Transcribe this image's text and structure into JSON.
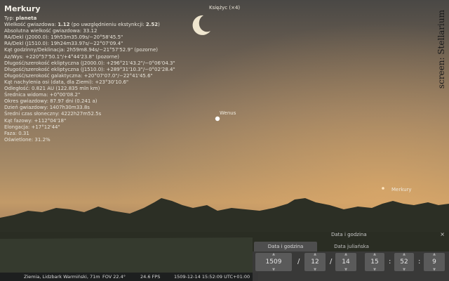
{
  "object": {
    "name": "Merkury",
    "type_label": "Typ:",
    "type_value": "planeta",
    "magnitude_label": "Wielkość gwiazdowa:",
    "magnitude_value": "1.12",
    "magnitude_ext_label": "(po uwzględnieniu ekstynkcji:",
    "magnitude_ext_value": "2.52",
    "magnitude_ext_close": ")",
    "lines": [
      "Absolutna wielkość gwiazdowa: 33.12",
      "RA/Dekl (J2000.0): 19h53m35.09s/−20°58'45.5\"",
      "RA/Dekl (J1510.0): 19h24m33.97s/−22°07'09.4\"",
      "Kąt godzinny/Deklinacja: 2h59m8.94s/−21°57'52.9\" (pozorne)",
      "Az/Wys: +220°57'50.1\"/+4°44'23.8\" (pozorne)",
      "Długość/szerokość ekliptyczna (J2000.0): +296°21'43.2\"/−0°06'04.3\"",
      "Długość/szerokość ekliptyczna (J1510.0): +289°31'10.3\"/−0°02'28.4\"",
      "Długość/szerokość galaktyczna: +20°07'07.0\"/−22°41'45.6\"",
      "Kąt nachylenia osi (data, dla Ziemi): +23°30'10.6\"",
      "Odległość: 0.821 AU (122.835 mln km)",
      "Średnica widoma: +0°00'08.2\"",
      "Okres gwiazdowy: 87.97 dni (0.241 a)",
      "Dzień gwiazdowy: 1407h30m33.8s",
      "Średni czas słoneczny: 4222h27m52.5s",
      "Kąt fazowy: +112°04'18\"",
      "Elongacja: +17°12'44\"",
      "Faza: 0.31",
      "Oświetlone: 31.2%"
    ]
  },
  "sky_labels": {
    "moon": "Księżyc (×4)",
    "venus": "Wenus",
    "mercury": "Merkury"
  },
  "watermark": "screen: Stellarium",
  "status_bar": {
    "location": "Ziemia, Lidzbark Warmiński, 71m",
    "fov": "FOV 22.4°",
    "fps": "24.6 FPS",
    "datetime": "1509-12-14   15:52:09 UTC+01:00"
  },
  "datetime_panel": {
    "title": "Data i godzina",
    "close_icon": "×",
    "tab_datetime": "Data i godzina",
    "tab_julian": "Data juliańska",
    "year": "1509",
    "month": "12",
    "day": "14",
    "hour": "15",
    "minute": "52",
    "second": "9",
    "date_sep": "/",
    "time_sep": ":",
    "up_arrow": "▲",
    "down_arrow": "▼"
  }
}
